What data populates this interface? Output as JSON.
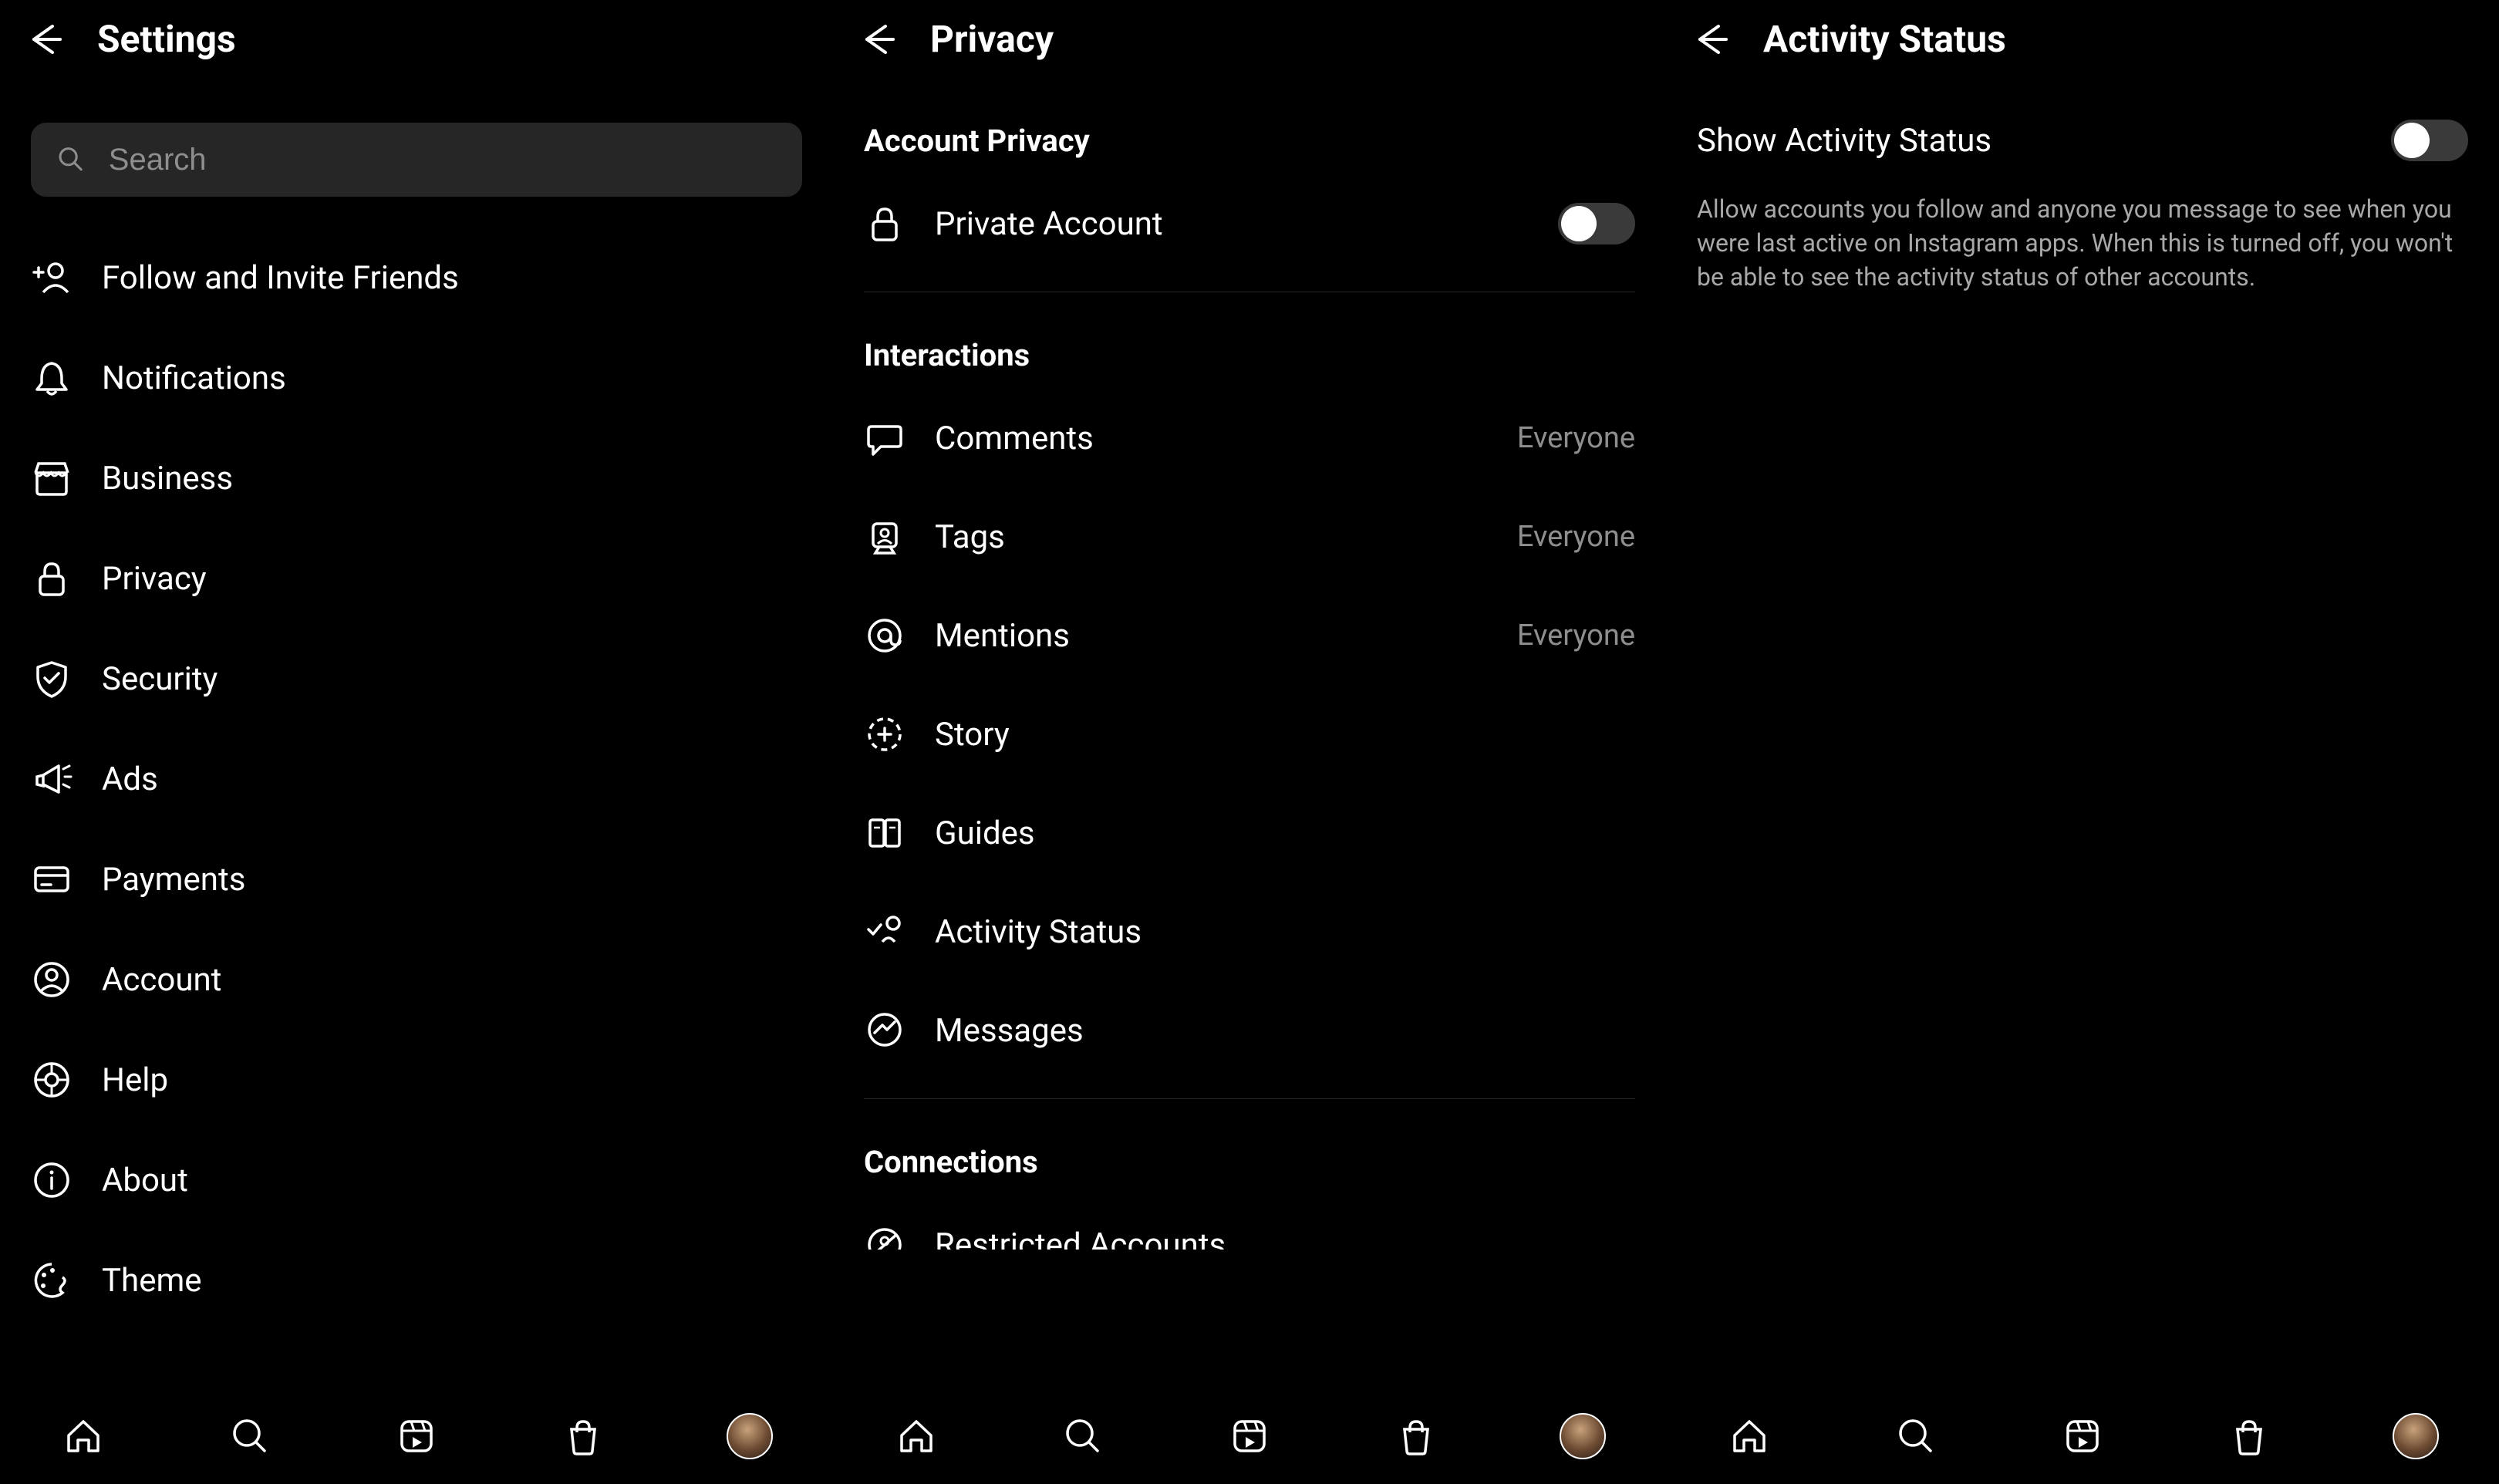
{
  "panel1": {
    "title": "Settings",
    "search_placeholder": "Search",
    "items": [
      {
        "name": "follow-invite",
        "label": "Follow and Invite Friends",
        "icon": "add-user-icon"
      },
      {
        "name": "notifications",
        "label": "Notifications",
        "icon": "bell-icon"
      },
      {
        "name": "business",
        "label": "Business",
        "icon": "storefront-icon"
      },
      {
        "name": "privacy",
        "label": "Privacy",
        "icon": "lock-icon"
      },
      {
        "name": "security",
        "label": "Security",
        "icon": "shield-icon"
      },
      {
        "name": "ads",
        "label": "Ads",
        "icon": "megaphone-icon"
      },
      {
        "name": "payments",
        "label": "Payments",
        "icon": "card-icon"
      },
      {
        "name": "account",
        "label": "Account",
        "icon": "user-circle-icon"
      },
      {
        "name": "help",
        "label": "Help",
        "icon": "lifebuoy-icon"
      },
      {
        "name": "about",
        "label": "About",
        "icon": "info-icon"
      },
      {
        "name": "theme",
        "label": "Theme",
        "icon": "palette-icon"
      }
    ]
  },
  "panel2": {
    "title": "Privacy",
    "section_account": "Account Privacy",
    "private_account": {
      "label": "Private Account",
      "on": false
    },
    "section_interactions": "Interactions",
    "interactions": [
      {
        "name": "comments",
        "label": "Comments",
        "value": "Everyone",
        "icon": "comment-icon"
      },
      {
        "name": "tags",
        "label": "Tags",
        "value": "Everyone",
        "icon": "tag-icon"
      },
      {
        "name": "mentions",
        "label": "Mentions",
        "value": "Everyone",
        "icon": "mention-icon"
      },
      {
        "name": "story",
        "label": "Story",
        "value": "",
        "icon": "story-icon"
      },
      {
        "name": "guides",
        "label": "Guides",
        "value": "",
        "icon": "guides-icon"
      },
      {
        "name": "activity-status",
        "label": "Activity Status",
        "value": "",
        "icon": "activity-icon"
      },
      {
        "name": "messages",
        "label": "Messages",
        "value": "",
        "icon": "messenger-icon"
      }
    ],
    "section_connections": "Connections",
    "connections": [
      {
        "name": "restricted",
        "label": "Restricted Accounts",
        "icon": "restricted-icon"
      }
    ]
  },
  "panel3": {
    "title": "Activity Status",
    "toggle": {
      "label": "Show Activity Status",
      "on": false
    },
    "description": "Allow accounts you follow and anyone you message to see when you were last active on Instagram apps. When this is turned off, you won't be able to see the activity status of other accounts."
  },
  "navbar": [
    "home",
    "search",
    "reels",
    "shop",
    "profile"
  ]
}
